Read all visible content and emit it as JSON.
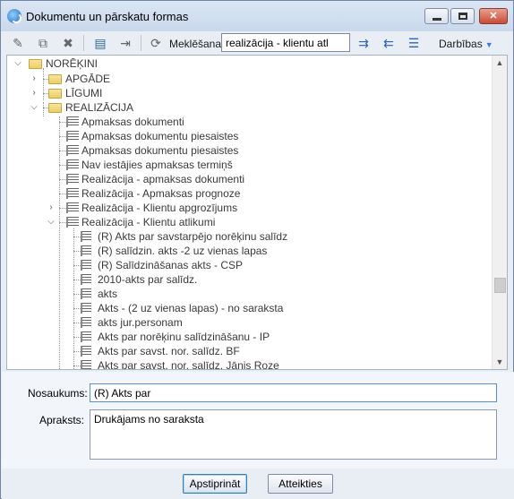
{
  "window": {
    "title": "Dokumentu un pārskatu formas"
  },
  "toolbar": {
    "icons": [
      "edit-icon",
      "copy-icon",
      "delete-icon",
      "export-icon",
      "import-icon",
      "refresh-icon",
      "expand-all-icon",
      "collapse-all-icon",
      "filter-icon"
    ],
    "search_label": "Meklēšana:",
    "search_value": "realizācija - klientu atl",
    "actions_label": "Darbības"
  },
  "tree": {
    "root": "NORĒĶINI",
    "folders": [
      "APGĀDE",
      "LĪGUMI",
      "REALIZĀCIJA"
    ],
    "realizacija_items": [
      "Apmaksas dokumenti",
      "Apmaksas dokumentu piesaistes",
      "Apmaksas dokumentu piesaistes",
      "Nav iestājies apmaksas termiņš",
      "Realizācija - apmaksas dokumenti",
      "Realizācija - Apmaksas prognoze",
      "Realizācija - Klientu apgrozījums",
      "Realizācija - Klientu atlikumi"
    ],
    "klientu_atlikumi_items": [
      "(R) Akts par savstarpējo norēķinu salīdz",
      "(R) salīdzin. akts -2 uz vienas lapas",
      "(R) Salīdzināšanas akts - CSP",
      "2010-akts par salīdz.",
      "akts",
      "Akts - (2 uz vienas lapas) - no saraksta",
      "akts jur.personam",
      "Akts par norēķinu salīdzināšanu - IP",
      "Akts par savst. nor. salīdz. BF",
      "Akts par savst. nor. salīdz. Jānis Roze"
    ]
  },
  "form": {
    "name_label": "Nosaukums:",
    "name_value": "(R) Akts par",
    "desc_label": "Apraksts:",
    "desc_value": "Drukājams no saraksta"
  },
  "buttons": {
    "confirm": "Apstiprināt",
    "cancel": "Atteikties"
  }
}
